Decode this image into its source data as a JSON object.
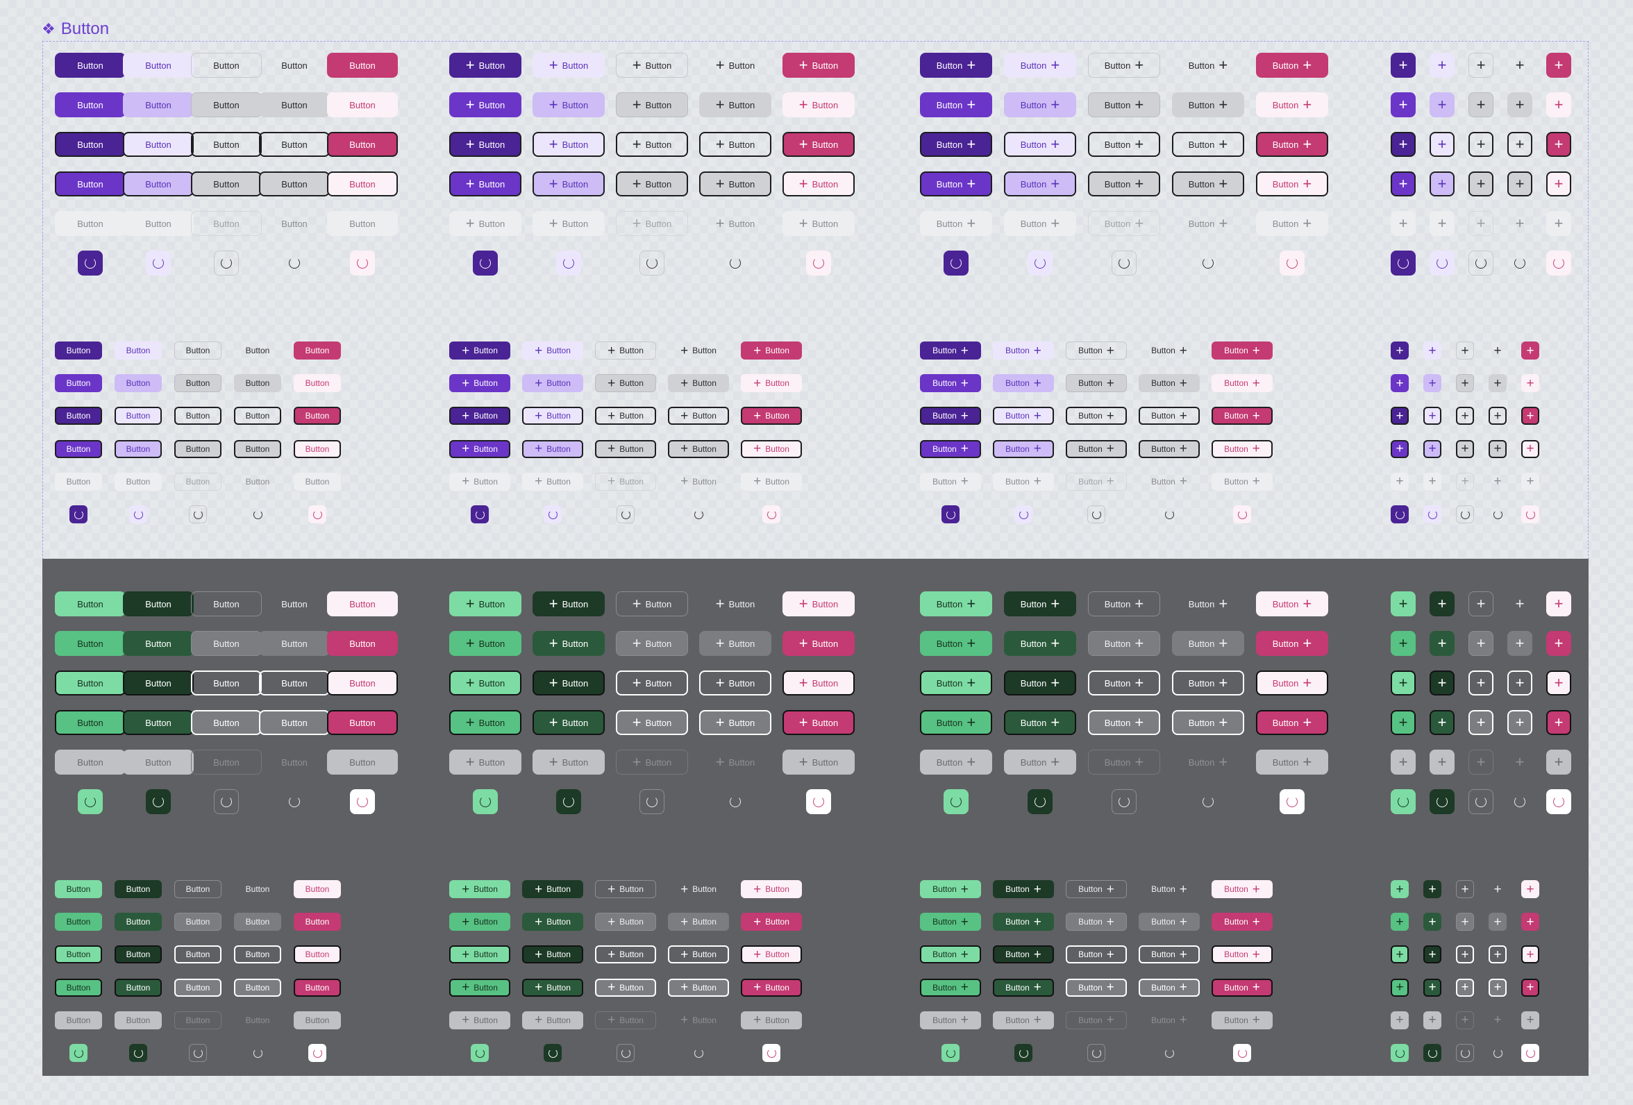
{
  "frame": {
    "title": "Button",
    "icon": "component-icon"
  },
  "button_label": "Button",
  "icons": {
    "plus": "+",
    "plus_name": "plus-icon",
    "spinner_name": "spinner-icon"
  },
  "variants": [
    "primary",
    "secondary",
    "outline",
    "ghost",
    "danger"
  ],
  "rows": [
    "default",
    "hover",
    "focus",
    "pressed",
    "disabled",
    "loading"
  ],
  "layouts": [
    "text",
    "icon-left",
    "icon-right",
    "icon-only"
  ],
  "sizes": [
    "medium",
    "small"
  ],
  "themes": {
    "light": {
      "primary": [
        {
          "bg": "#4a2395",
          "fg": "#ffffff",
          "bd": "transparent"
        },
        {
          "bg": "#6b35c8",
          "fg": "#ffffff",
          "bd": "transparent"
        },
        {
          "bg": "#4a2395",
          "fg": "#ffffff",
          "bd": "#1d1d1f"
        },
        {
          "bg": "#6b35c8",
          "fg": "#ffffff",
          "bd": "#1d1d1f"
        },
        {
          "bg": "#eceef0",
          "fg": "#8a8c90",
          "bd": "transparent"
        },
        {
          "bg": "#4a2395",
          "fg": "#ffffff",
          "bd": "transparent"
        }
      ],
      "secondary": [
        {
          "bg": "#ece6fc",
          "fg": "#5b31b8",
          "bd": "transparent"
        },
        {
          "bg": "#cdbcf6",
          "fg": "#5b31b8",
          "bd": "transparent"
        },
        {
          "bg": "#ece6fc",
          "fg": "#5b31b8",
          "bd": "#1d1d1f"
        },
        {
          "bg": "#cdbcf6",
          "fg": "#5b31b8",
          "bd": "#1d1d1f"
        },
        {
          "bg": "#eceef0",
          "fg": "#8a8c90",
          "bd": "transparent"
        },
        {
          "bg": "#ece6fc",
          "fg": "#5b31b8",
          "bd": "transparent"
        }
      ],
      "outline": [
        {
          "bg": "transparent",
          "fg": "#2b2c30",
          "bd": "#c6c8cc"
        },
        {
          "bg": "#cfd1d4",
          "fg": "#2b2c30",
          "bd": "#b9bbbf"
        },
        {
          "bg": "transparent",
          "fg": "#2b2c30",
          "bd": "#1d1d1f"
        },
        {
          "bg": "#cfd1d4",
          "fg": "#2b2c30",
          "bd": "#1d1d1f"
        },
        {
          "bg": "transparent",
          "fg": "#a0a2a6",
          "bd": "#d5d7da"
        },
        {
          "bg": "transparent",
          "fg": "#2b2c30",
          "bd": "#c6c8cc"
        }
      ],
      "ghost": [
        {
          "bg": "transparent",
          "fg": "#2b2c30",
          "bd": "transparent"
        },
        {
          "bg": "#cfd1d4",
          "fg": "#2b2c30",
          "bd": "transparent"
        },
        {
          "bg": "transparent",
          "fg": "#2b2c30",
          "bd": "#1d1d1f"
        },
        {
          "bg": "#cfd1d4",
          "fg": "#2b2c30",
          "bd": "#1d1d1f"
        },
        {
          "bg": "transparent",
          "fg": "#8a8c90",
          "bd": "transparent"
        },
        {
          "bg": "transparent",
          "fg": "#2b2c30",
          "bd": "transparent"
        }
      ],
      "danger": [
        {
          "bg": "#c43a72",
          "fg": "#ffffff",
          "bd": "transparent"
        },
        {
          "bg": "#fcf1f6",
          "fg": "#c43a72",
          "bd": "transparent"
        },
        {
          "bg": "#c43a72",
          "fg": "#ffffff",
          "bd": "#1d1d1f"
        },
        {
          "bg": "#fcf1f6",
          "fg": "#c43a72",
          "bd": "#1d1d1f"
        },
        {
          "bg": "#eceef0",
          "fg": "#8a8c90",
          "bd": "transparent"
        },
        {
          "bg": "#fcf1f6",
          "fg": "#c43a72",
          "bd": "transparent"
        }
      ]
    },
    "dark": {
      "primary": [
        {
          "bg": "#7ddca4",
          "fg": "#17301f",
          "bd": "transparent"
        },
        {
          "bg": "#57c283",
          "fg": "#17301f",
          "bd": "transparent"
        },
        {
          "bg": "#7ddca4",
          "fg": "#17301f",
          "bd": "#111213"
        },
        {
          "bg": "#57c283",
          "fg": "#17301f",
          "bd": "#111213"
        },
        {
          "bg": "#bfc1c4",
          "fg": "#6a6c70",
          "bd": "transparent"
        },
        {
          "bg": "#7ddca4",
          "fg": "#17301f",
          "bd": "transparent"
        }
      ],
      "secondary": [
        {
          "bg": "#1c3a26",
          "fg": "#ffffff",
          "bd": "transparent"
        },
        {
          "bg": "#2a5a3b",
          "fg": "#ffffff",
          "bd": "transparent"
        },
        {
          "bg": "#1c3a26",
          "fg": "#ffffff",
          "bd": "#111213"
        },
        {
          "bg": "#2a5a3b",
          "fg": "#ffffff",
          "bd": "#111213"
        },
        {
          "bg": "#bfc1c4",
          "fg": "#6a6c70",
          "bd": "transparent"
        },
        {
          "bg": "#1c3a26",
          "fg": "#ffffff",
          "bd": "transparent"
        }
      ],
      "outline": [
        {
          "bg": "transparent",
          "fg": "#f0f0f2",
          "bd": "#8b8d91"
        },
        {
          "bg": "#7b7d81",
          "fg": "#f0f0f2",
          "bd": "#8b8d91"
        },
        {
          "bg": "transparent",
          "fg": "#ffffff",
          "bd": "#ffffff"
        },
        {
          "bg": "#7b7d81",
          "fg": "#ffffff",
          "bd": "#ffffff"
        },
        {
          "bg": "transparent",
          "fg": "#8f9195",
          "bd": "#76787c"
        },
        {
          "bg": "transparent",
          "fg": "#f0f0f2",
          "bd": "#8b8d91"
        }
      ],
      "ghost": [
        {
          "bg": "transparent",
          "fg": "#f0f0f2",
          "bd": "transparent"
        },
        {
          "bg": "#7b7d81",
          "fg": "#f0f0f2",
          "bd": "transparent"
        },
        {
          "bg": "transparent",
          "fg": "#ffffff",
          "bd": "#ffffff"
        },
        {
          "bg": "#7b7d81",
          "fg": "#ffffff",
          "bd": "#ffffff"
        },
        {
          "bg": "transparent",
          "fg": "#8f9195",
          "bd": "transparent"
        },
        {
          "bg": "transparent",
          "fg": "#f0f0f2",
          "bd": "transparent"
        }
      ],
      "danger": [
        {
          "bg": "#fcf1f6",
          "fg": "#c43a72",
          "bd": "transparent"
        },
        {
          "bg": "#c43a72",
          "fg": "#ffffff",
          "bd": "transparent"
        },
        {
          "bg": "#fcf1f6",
          "fg": "#c43a72",
          "bd": "#111213"
        },
        {
          "bg": "#c43a72",
          "fg": "#ffffff",
          "bd": "#111213"
        },
        {
          "bg": "#bfc1c4",
          "fg": "#6a6c70",
          "bd": "transparent"
        },
        {
          "bg": "#ffffff",
          "fg": "#c43a72",
          "bd": "transparent"
        }
      ]
    }
  }
}
